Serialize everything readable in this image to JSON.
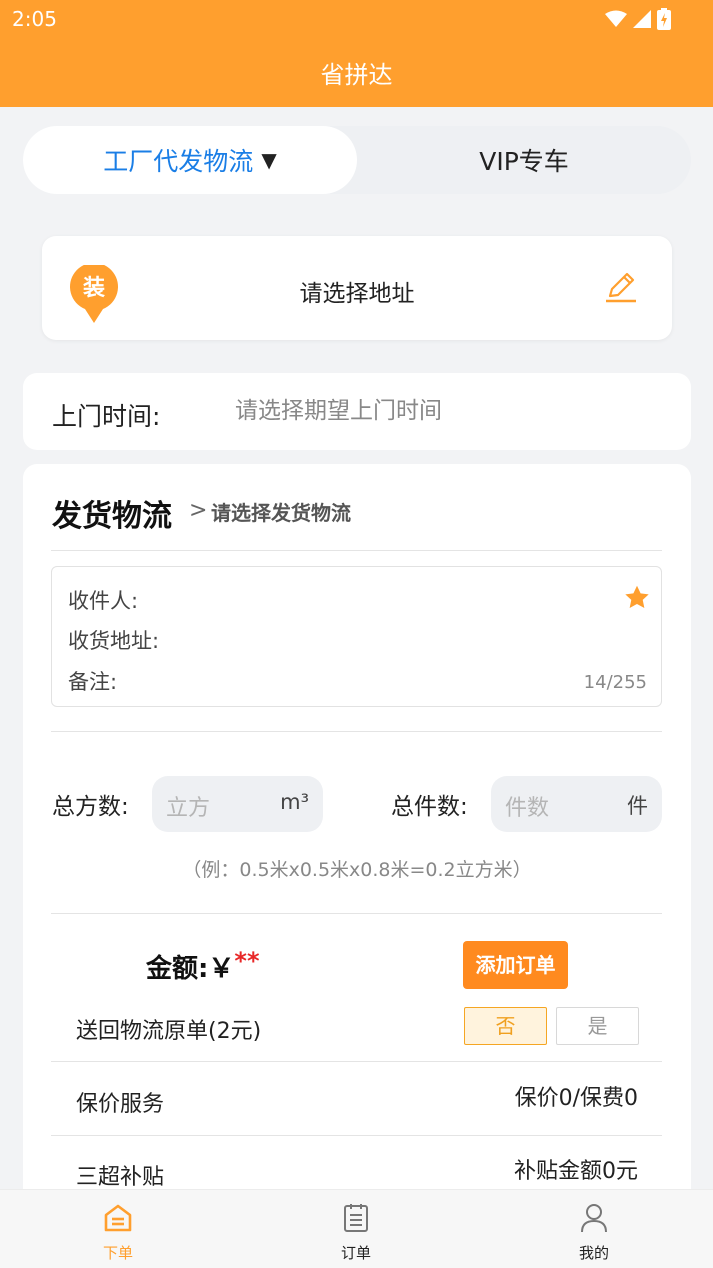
{
  "status_bar": {
    "time": "2:05"
  },
  "header": {
    "title": "省拼达"
  },
  "segment": {
    "left_label": "工厂代发物流",
    "left_caret": "▼",
    "right_label": "VIP专车"
  },
  "address": {
    "badge": "装",
    "text": "请选择地址"
  },
  "pickup": {
    "label": "上门时间:",
    "placeholder": "请选择期望上门时间"
  },
  "shipping": {
    "title": "发货物流",
    "arrow": ">",
    "hint": "请选择发货物流",
    "receiver_label": "收件人:",
    "address_label": "收货地址:",
    "remark_label": "备注:",
    "remark_count": "14/255"
  },
  "quantity": {
    "volume_label": "总方数:",
    "volume_placeholder": "立方",
    "volume_unit": "m³",
    "pieces_label": "总件数:",
    "pieces_placeholder": "件数",
    "pieces_unit": "件",
    "example": "（例：0.5米x0.5米x0.8米=0.2立方米）"
  },
  "amount": {
    "label": "金额:￥",
    "stars": "**",
    "add_order": "添加订单"
  },
  "options": {
    "return_label": "送回物流原单(2元)",
    "no": "否",
    "yes": "是",
    "selected": "否",
    "insurance_label": "保价服务",
    "insurance_value": "保价0/保费0",
    "subsidy_label": "三超补贴",
    "subsidy_value": "补贴金额0元"
  },
  "tabbar": {
    "items": [
      "下单",
      "订单",
      "我的"
    ],
    "active": 0
  },
  "colors": {
    "brand": "#ff9f2e",
    "link": "#1a7ee6",
    "accent_red": "#e82828"
  }
}
